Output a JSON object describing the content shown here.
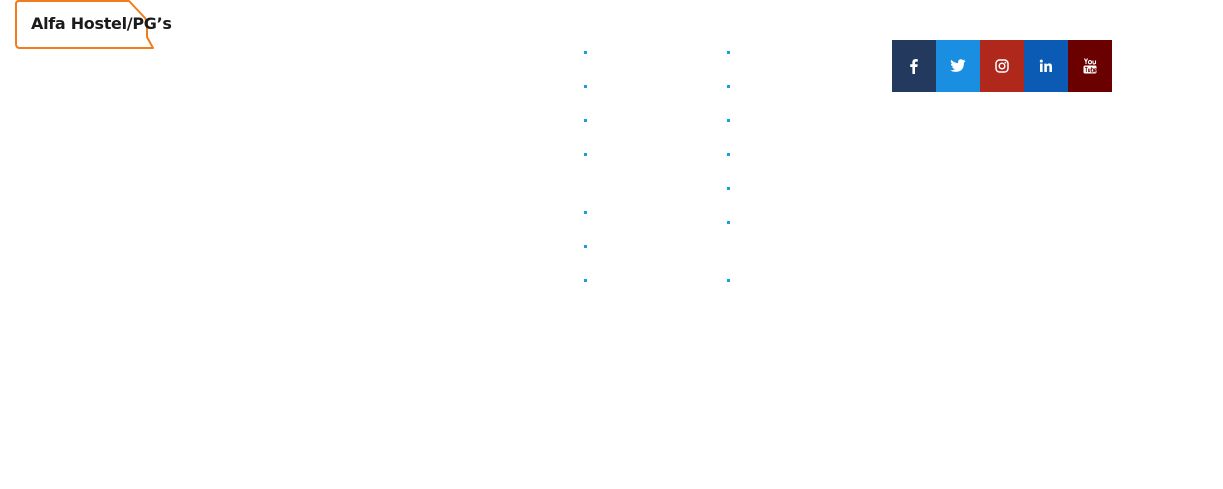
{
  "brand": {
    "name": "Alfa Hostel/PG’s",
    "frame_color": "#f07c1c"
  },
  "footer_links": {
    "dot_color": "#1aa0d8",
    "column_1": [
      {
        "label": ""
      },
      {
        "label": ""
      },
      {
        "label": ""
      },
      {
        "label": ""
      },
      {
        "label": ""
      },
      {
        "label": ""
      },
      {
        "label": ""
      }
    ],
    "column_2": [
      {
        "label": ""
      },
      {
        "label": ""
      },
      {
        "label": ""
      },
      {
        "label": ""
      },
      {
        "label": ""
      },
      {
        "label": ""
      },
      {
        "label": ""
      }
    ]
  },
  "social": [
    {
      "icon": "facebook-icon",
      "color": "#23395d"
    },
    {
      "icon": "twitter-icon",
      "color": "#1a8ee0"
    },
    {
      "icon": "instagram-icon",
      "color": "#b0271c"
    },
    {
      "icon": "linkedin-icon",
      "color": "#0b5bb5"
    },
    {
      "icon": "youtube-icon",
      "color": "#6b0000"
    }
  ]
}
